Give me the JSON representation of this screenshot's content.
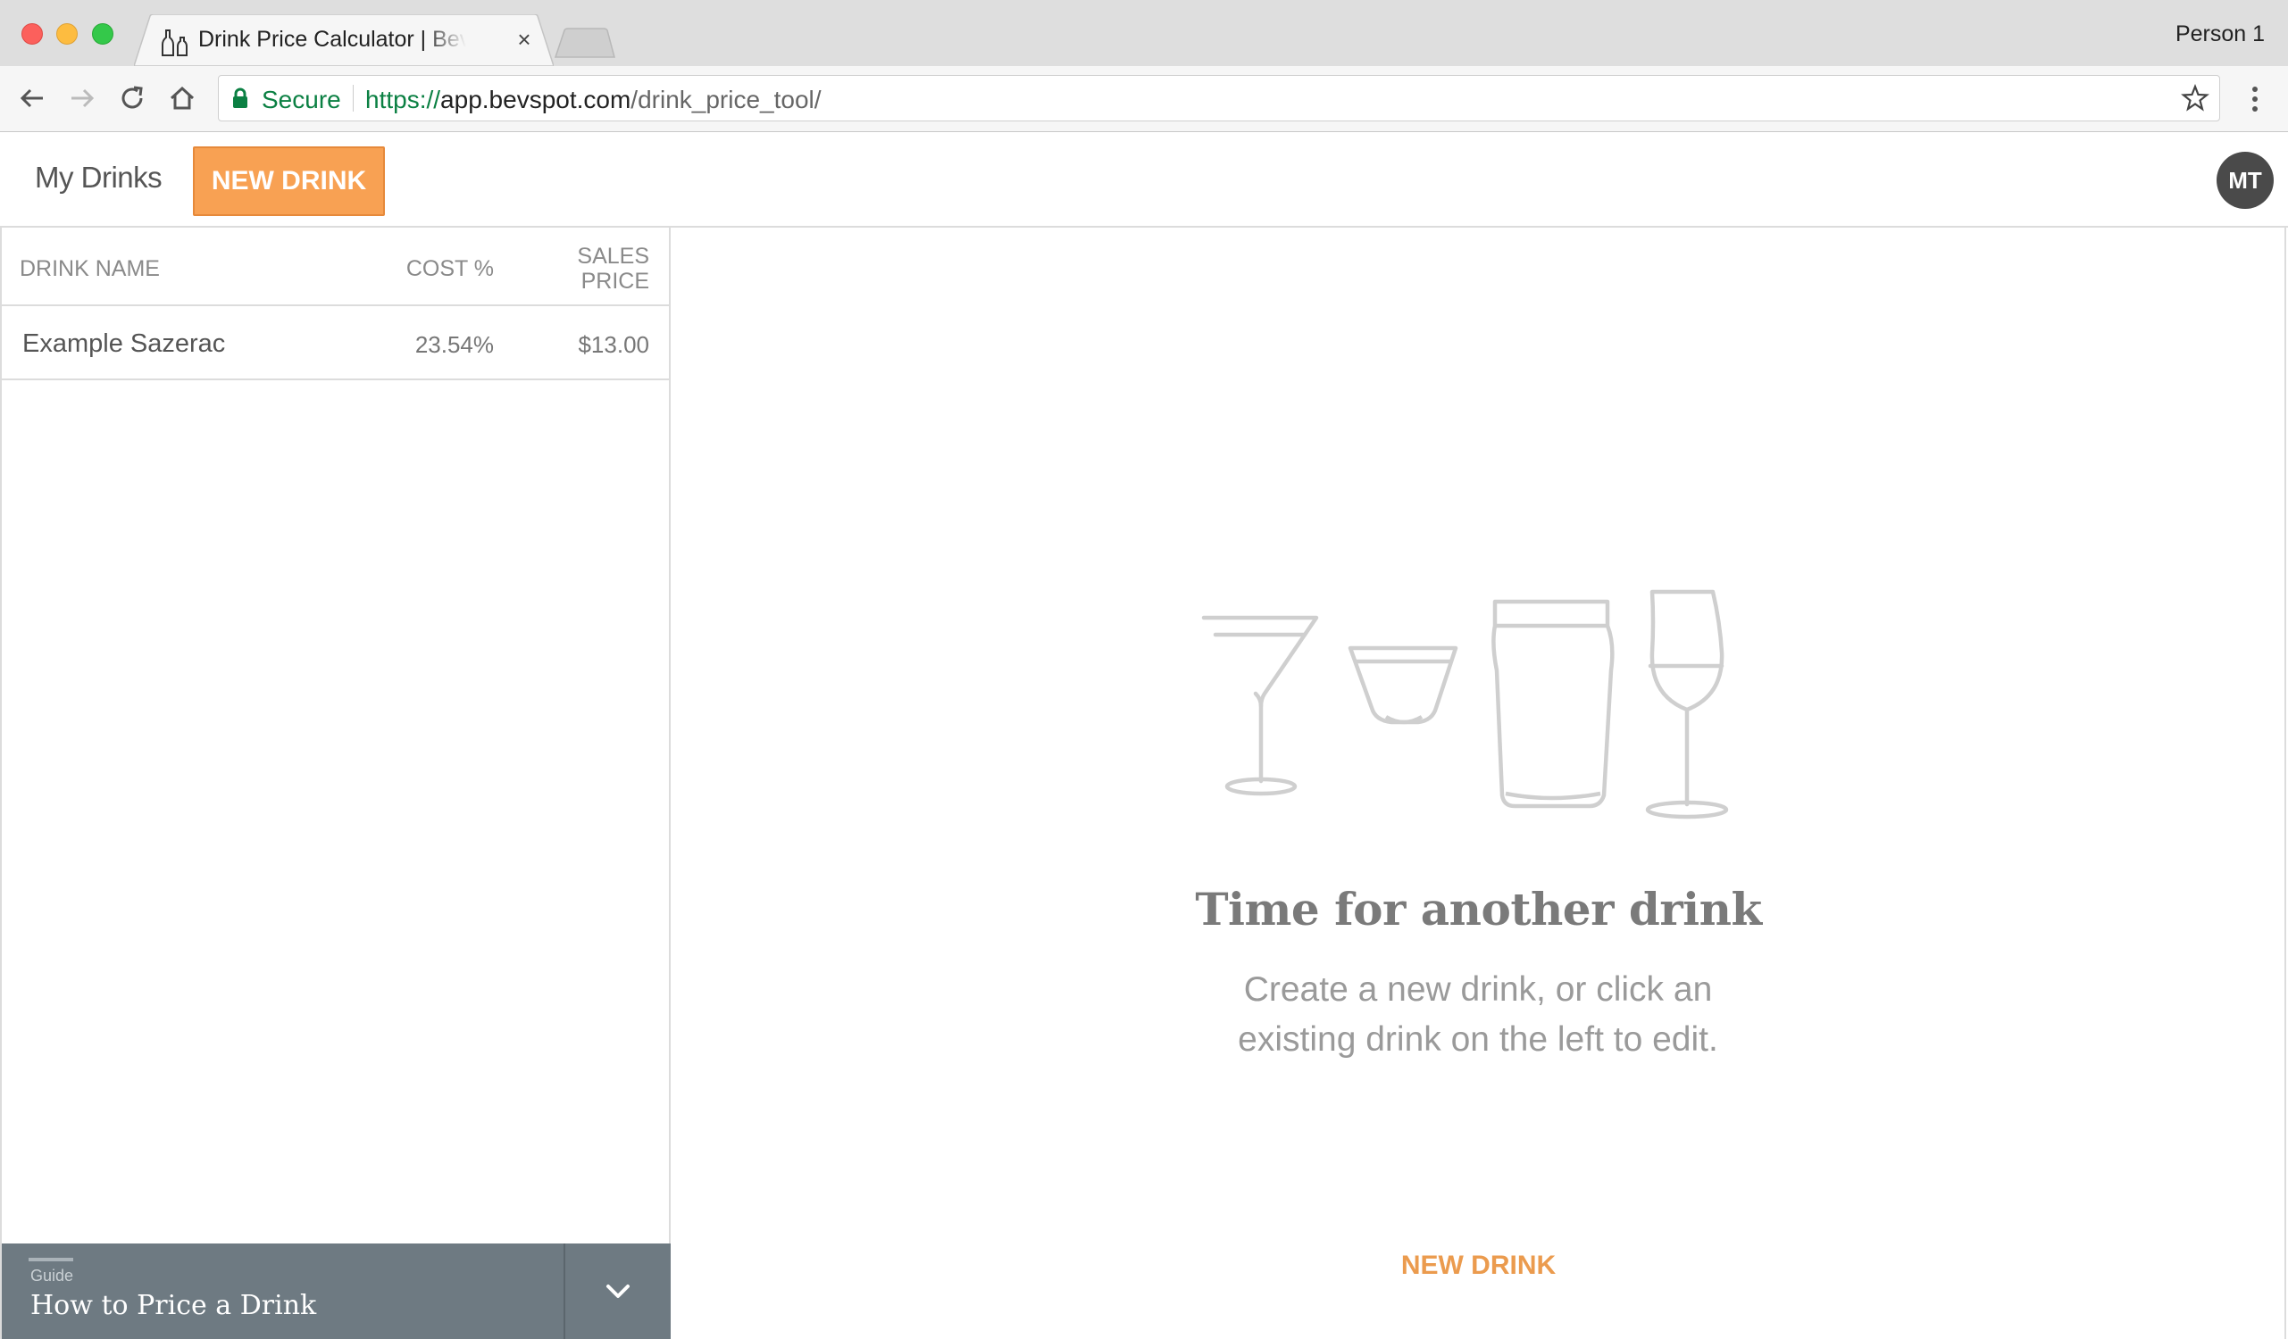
{
  "browser": {
    "tab_title": "Drink Price Calculator | BevSpot",
    "tab_close": "×",
    "profile_name": "Person 1",
    "secure_label": "Secure",
    "url_scheme": "https://",
    "url_host": "app.bevspot.com",
    "url_path": "/drink_price_tool/"
  },
  "header": {
    "my_drinks_label": "My Drinks",
    "new_drink_button": "NEW DRINK",
    "avatar_initials": "MT"
  },
  "sidebar": {
    "columns": {
      "name": "DRINK NAME",
      "cost": "COST %",
      "price_line1": "SALES",
      "price_line2": "PRICE"
    },
    "rows": [
      {
        "name": "Example Sazerac",
        "cost": "23.54%",
        "price": "$13.00"
      }
    ],
    "guide": {
      "label": "Guide",
      "title": "How to Price a Drink"
    }
  },
  "main": {
    "empty_title": "Time for another drink",
    "empty_subtitle": "Create a new drink, or click an existing drink on the left to edit.",
    "new_drink_link": "NEW DRINK"
  },
  "icons": {
    "back": "back-arrow-icon",
    "forward": "forward-arrow-icon",
    "reload": "reload-icon",
    "home": "home-icon",
    "lock": "lock-icon",
    "star": "star-icon",
    "menu": "kebab-menu-icon",
    "favicon": "bevspot-bottles-icon",
    "chevron": "chevron-down-icon",
    "illustration": [
      "martini-glass-icon",
      "rocks-glass-icon",
      "pint-glass-icon",
      "wine-glass-icon"
    ]
  },
  "colors": {
    "accent": "#f8a153",
    "link": "#eb9b4e",
    "secure": "#0b8043",
    "guide_bg": "#6e7a82",
    "avatar_bg": "#4a4a4a"
  }
}
